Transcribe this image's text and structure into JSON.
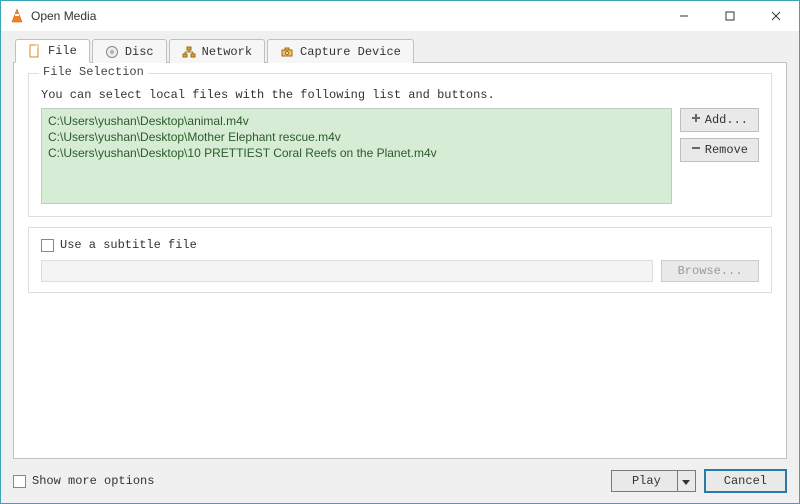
{
  "window": {
    "title": "Open Media"
  },
  "tabs": [
    {
      "label": "File"
    },
    {
      "label": "Disc"
    },
    {
      "label": "Network"
    },
    {
      "label": "Capture Device"
    }
  ],
  "fileSelection": {
    "legend": "File Selection",
    "hint": "You can select local files with the following list and buttons.",
    "files": [
      "C:\\Users\\yushan\\Desktop\\animal.m4v",
      "C:\\Users\\yushan\\Desktop\\Mother Elephant rescue.m4v",
      "C:\\Users\\yushan\\Desktop\\10 PRETTIEST Coral Reefs on the Planet.m4v"
    ],
    "addLabel": "Add...",
    "removeLabel": "Remove"
  },
  "subtitle": {
    "checkboxLabel": "Use a subtitle file",
    "browseLabel": "Browse..."
  },
  "footer": {
    "showMoreLabel": "Show more options",
    "playLabel": "Play",
    "cancelLabel": "Cancel"
  }
}
